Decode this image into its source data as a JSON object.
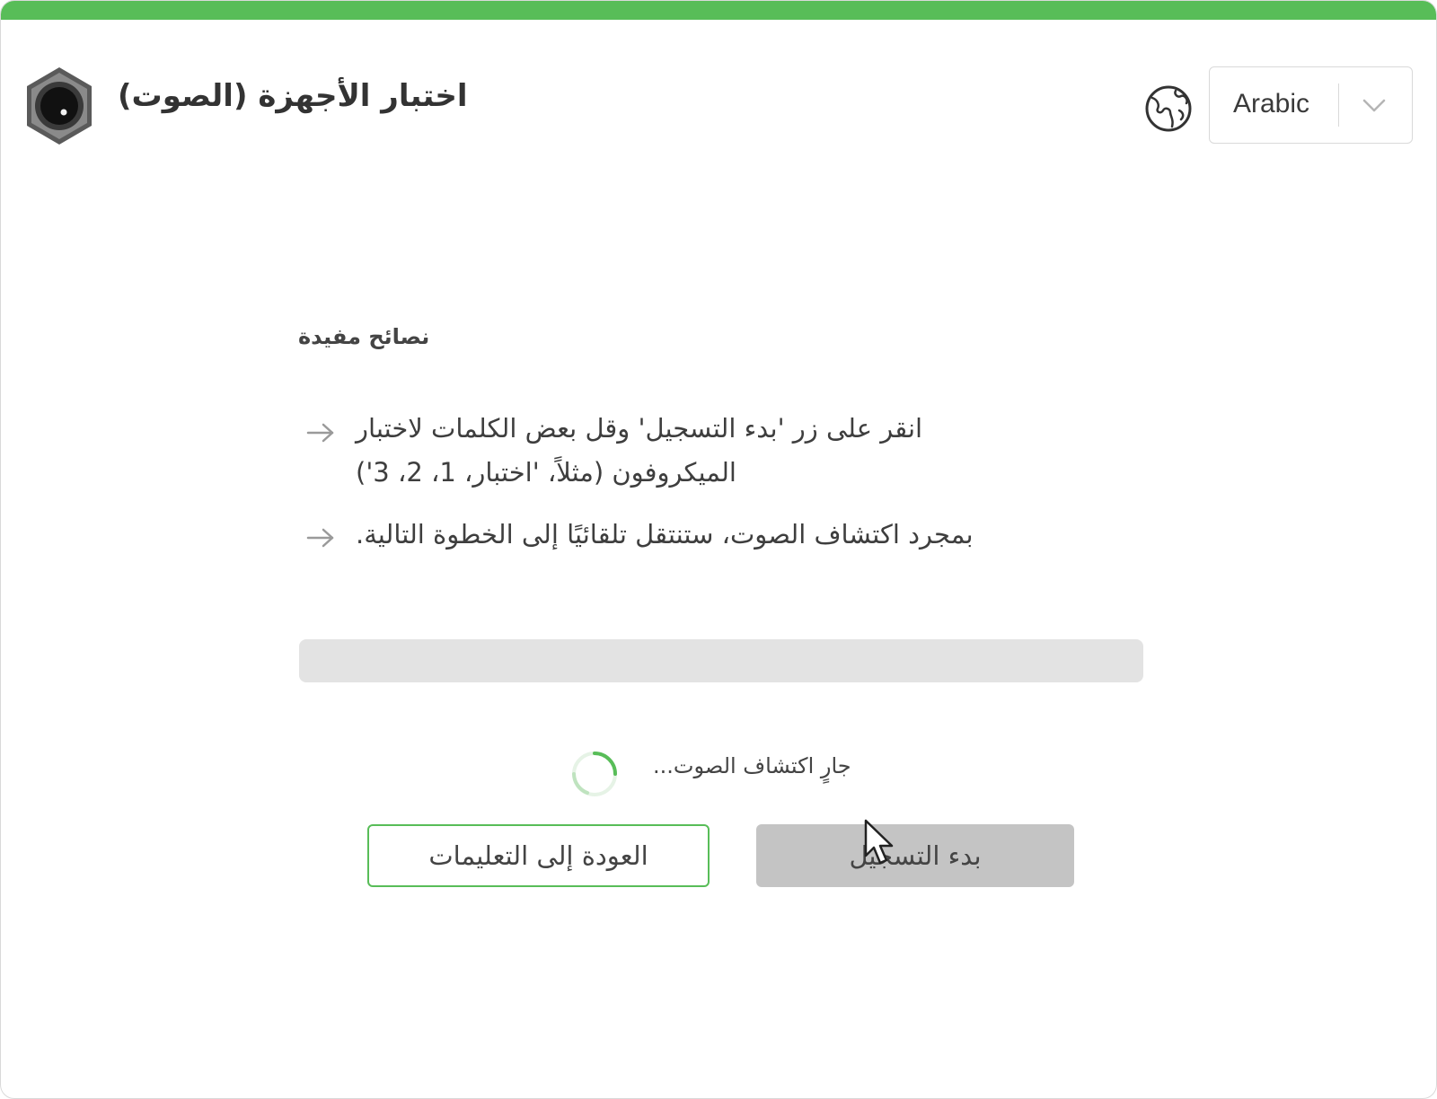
{
  "app": {
    "title": "اختبار الأجهزة (الصوت)",
    "logo_icon": "camera-lens-icon"
  },
  "header": {
    "language_icon": "globe-icon",
    "language_value": "Arabic",
    "dropdown_icon": "chevron-down-icon"
  },
  "tips": {
    "title": "نصائح مفيدة",
    "items": [
      {
        "icon": "arrow-right-icon",
        "text": "انقر على زر 'بدء التسجيل' وقل بعض الكلمات لاختبار الميكروفون (مثلاً، 'اختبار، 1، 2، 3')"
      },
      {
        "icon": "arrow-right-icon",
        "text": "بمجرد اكتشاف الصوت، ستنتقل تلقائيًا إلى الخطوة التالية."
      }
    ]
  },
  "audio_level": {
    "progress_fraction": 0
  },
  "status": {
    "icon": "loading-spinner-icon",
    "text": "جارٍ اكتشاف الصوت..."
  },
  "actions": {
    "back_label": "العودة إلى التعليمات",
    "record_label": "بدء التسجيل"
  },
  "colors": {
    "accent": "#58bd58",
    "disabled_button": "#c4c4c4",
    "track": "#e3e3e3"
  }
}
